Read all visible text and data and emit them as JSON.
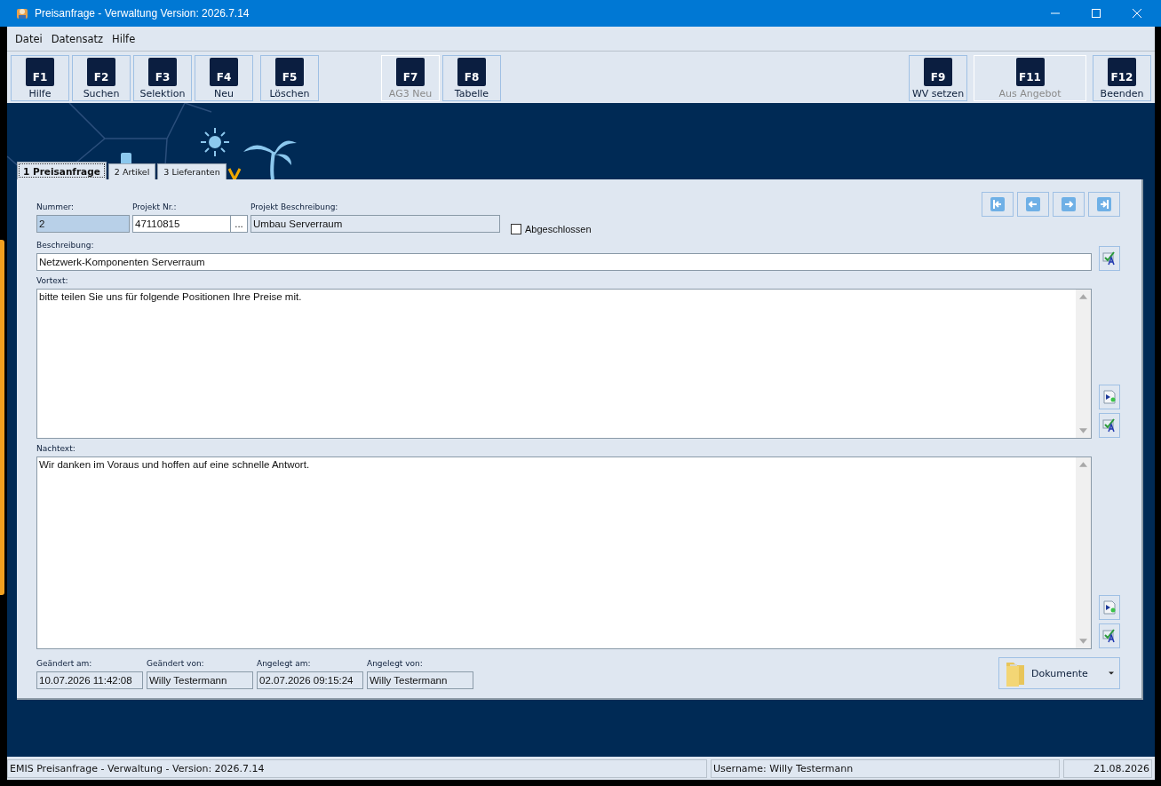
{
  "window": {
    "title": "Preisanfrage - Verwaltung Version: 2026.7.14"
  },
  "menu": [
    "Datei",
    "Datensatz",
    "Hilfe"
  ],
  "toolbar_groups": [
    [
      {
        "key": "F1",
        "label": "Hilfe",
        "disabled": false
      },
      {
        "key": "F2",
        "label": "Suchen",
        "disabled": false
      },
      {
        "key": "F3",
        "label": "Selektion",
        "disabled": false
      },
      {
        "key": "F4",
        "label": "Neu",
        "disabled": false
      }
    ],
    [
      {
        "key": "F5",
        "label": "Löschen",
        "disabled": false
      }
    ],
    [
      {
        "key": "F7",
        "label": "AG3 Neu",
        "disabled": true
      },
      {
        "key": "F8",
        "label": "Tabelle",
        "disabled": false
      }
    ],
    [
      {
        "key": "F9",
        "label": "WV setzen",
        "disabled": false
      },
      {
        "key": "F11",
        "label": "Aus Angebot",
        "disabled": true
      },
      {
        "key": "F12",
        "label": "Beenden",
        "disabled": false
      }
    ]
  ],
  "tabs": [
    {
      "label": "1 Preisanfrage",
      "selected": true
    },
    {
      "label": "2 Artikel",
      "selected": false
    },
    {
      "label": "3 Lieferanten",
      "selected": false
    }
  ],
  "header_fields": [
    {
      "label": "Nummer:",
      "value": "2",
      "readonly": true,
      "selected": true
    },
    {
      "label": "Projekt Nr.:",
      "value": "47110815",
      "readonly": false,
      "selected": false,
      "lookup": "..."
    },
    {
      "label": "Projekt Beschreibung:",
      "value": "Umbau Serverraum",
      "readonly": true,
      "selected": false
    }
  ],
  "closed_checkbox": {
    "label": "Abgeschlossen",
    "checked": false
  },
  "description": {
    "label": "Beschreibung:",
    "value": "Netzwerk-Komponenten Serverraum"
  },
  "texts": [
    {
      "label": "Vortext:",
      "value": "bitte teilen Sie uns für folgende Positionen Ihre Preise mit."
    },
    {
      "label": "Nachtext:",
      "value": "Wir danken im Voraus und hoffen auf eine schnelle Antwort."
    }
  ],
  "audit_fields": [
    {
      "label": "Geändert am:",
      "value": "10.07.2026 11:42:08"
    },
    {
      "label": "Geändert von:",
      "value": "Willy Testermann"
    },
    {
      "label": "Angelegt am:",
      "value": "02.07.2026 09:15:24"
    },
    {
      "label": "Angelegt von:",
      "value": "Willy Testermann"
    }
  ],
  "documents_button": {
    "label": "Dokumente"
  },
  "status_bar": [
    "EMIS Preisanfrage - Verwaltung - Version: 2026.7.14",
    "Username: Willy Testermann",
    "21.08.2026"
  ]
}
